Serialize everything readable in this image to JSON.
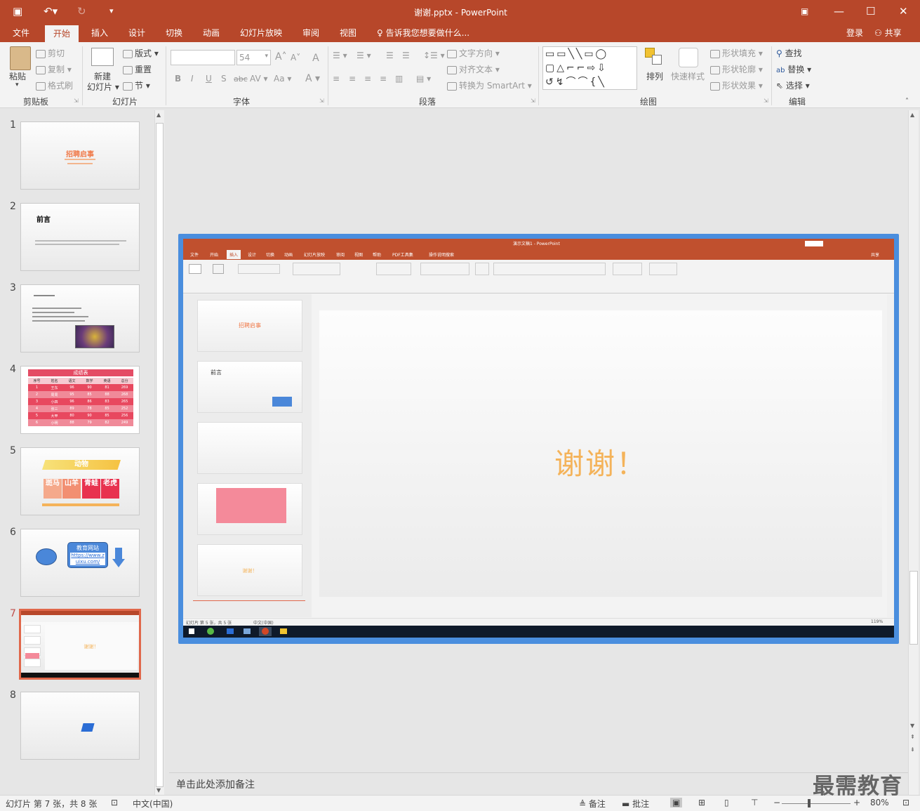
{
  "title_bar": {
    "doc_title": "谢谢.pptx - PowerPoint"
  },
  "tabs": [
    "文件",
    "开始",
    "插入",
    "设计",
    "切换",
    "动画",
    "幻灯片放映",
    "审阅",
    "视图"
  ],
  "tell_me": "告诉我您想要做什么...",
  "account": {
    "login": "登录",
    "share": "共享"
  },
  "ribbon": {
    "clipboard": {
      "paste": "粘贴",
      "cut": "剪切",
      "copy": "复制",
      "format_painter": "格式刷",
      "label": "剪贴板"
    },
    "slides": {
      "new_slide_line1": "新建",
      "new_slide_line2": "幻灯片",
      "layout": "版式",
      "reset": "重置",
      "section": "节",
      "label": "幻灯片"
    },
    "font": {
      "font_size": "54",
      "label": "字体"
    },
    "paragraph": {
      "text_direction": "文字方向",
      "align_text": "对齐文本",
      "smartart": "转换为 SmartArt",
      "label": "段落"
    },
    "drawing": {
      "arrange": "排列",
      "quick_styles": "快速样式",
      "shape_fill": "形状填充",
      "shape_outline": "形状轮廓",
      "shape_effects": "形状效果",
      "label": "绘图"
    },
    "editing": {
      "find": "查找",
      "replace": "替换",
      "select": "选择",
      "label": "编辑"
    }
  },
  "thumbnails": {
    "numbers": [
      "1",
      "2",
      "3",
      "4",
      "5",
      "6",
      "7",
      "8"
    ],
    "t1": {
      "title": "招聘启事"
    },
    "t2": {
      "title": "前言"
    },
    "t4": {
      "title": "成绩表",
      "headers": [
        "序号",
        "姓名",
        "语文",
        "数学",
        "英语",
        "总分"
      ],
      "rows": [
        [
          "1",
          "王东",
          "96",
          "90",
          "81",
          "269"
        ],
        [
          "2",
          "周周",
          "95",
          "85",
          "88",
          "268"
        ],
        [
          "3",
          "小四",
          "96",
          "86",
          "83",
          "265"
        ],
        [
          "4",
          "张三",
          "89",
          "78",
          "85",
          "252"
        ],
        [
          "5",
          "大甲",
          "80",
          "90",
          "85",
          "256"
        ],
        [
          "6",
          "小明",
          "88",
          "79",
          "82",
          "249"
        ]
      ]
    },
    "t5": {
      "title": "动物",
      "cells": [
        "斑马",
        "山羊",
        "青蛙",
        "老虎"
      ]
    },
    "t6": {
      "box_title": "教育网站",
      "link": "https://www.zuixu.com/"
    },
    "t7": {
      "text": "谢谢！"
    }
  },
  "slide": {
    "main_text": "谢谢！"
  },
  "inner": {
    "title": "演示文稿1 - PowerPoint",
    "tabs": [
      "文件",
      "开始",
      "插入",
      "设计",
      "切换",
      "动画",
      "幻灯片放映",
      "审阅",
      "视图",
      "帮助",
      "PDF工具集",
      "操作说明搜索"
    ],
    "share": "共享",
    "thumb1_title": "招聘启事",
    "thumb2_title": "前言",
    "thumb5_text": "谢谢！",
    "status_left": "幻灯片 第 5 张，共 5 张",
    "status_lang": "中文(中国)",
    "zoom": "119%"
  },
  "notes_placeholder": "单击此处添加备注",
  "status": {
    "slide_info": "幻灯片 第 7 张，共 8 张",
    "language": "中文(中国)",
    "notes": "备注",
    "comments": "批注",
    "zoom": "80%"
  },
  "watermark": "最需教育",
  "colors": {
    "accent": "#b7472a",
    "selection": "#e0684b",
    "slide_frame": "#4a8ede",
    "thanks_text": "#f4b35a"
  }
}
